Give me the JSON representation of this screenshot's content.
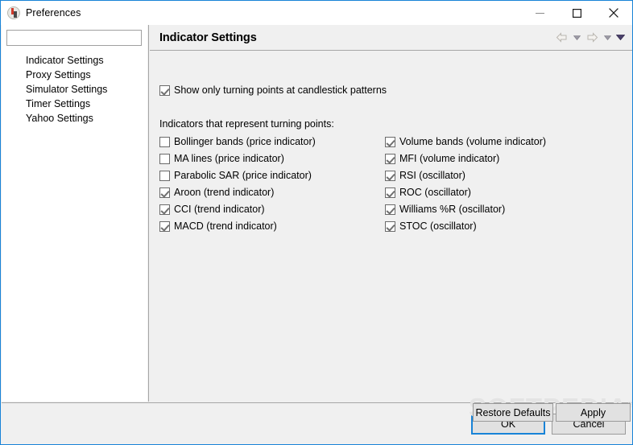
{
  "window": {
    "title": "Preferences",
    "icon": "app-icon",
    "controls": [
      {
        "name": "minimize",
        "glyph": "minimize-icon"
      },
      {
        "name": "maximize",
        "glyph": "maximize-icon"
      },
      {
        "name": "close",
        "glyph": "close-icon"
      }
    ]
  },
  "sidebar": {
    "filter": {
      "value": "",
      "placeholder": ""
    },
    "items": [
      {
        "label": "Indicator Settings",
        "selected": false
      },
      {
        "label": "Proxy Settings",
        "selected": false
      },
      {
        "label": "Simulator Settings",
        "selected": false
      },
      {
        "label": "Timer Settings",
        "selected": false
      },
      {
        "label": "Yahoo Settings",
        "selected": false
      }
    ]
  },
  "page": {
    "title": "Indicator Settings",
    "nav": [
      {
        "name": "back-arrow-icon",
        "label": "Back"
      },
      {
        "name": "back-dropdown-caret-icon",
        "label": "Back history"
      },
      {
        "name": "forward-arrow-icon",
        "label": "Forward"
      },
      {
        "name": "forward-dropdown-caret-icon",
        "label": "Forward history"
      },
      {
        "name": "menu-caret-icon",
        "label": "View menu"
      }
    ],
    "top_option": {
      "label": "Show only turning points at candlestick patterns",
      "checked": true
    },
    "group_caption": "Indicators that represent turning points:",
    "indicators_left": [
      {
        "label": "Bollinger bands (price indicator)",
        "checked": false
      },
      {
        "label": "MA lines (price indicator)",
        "checked": false
      },
      {
        "label": "Parabolic SAR (price indicator)",
        "checked": false
      },
      {
        "label": "Aroon (trend indicator)",
        "checked": true
      },
      {
        "label": "CCI (trend indicator)",
        "checked": true
      },
      {
        "label": "MACD (trend indicator)",
        "checked": true
      }
    ],
    "indicators_right": [
      {
        "label": "Volume bands (volume indicator)",
        "checked": true
      },
      {
        "label": "MFI (volume indicator)",
        "checked": true
      },
      {
        "label": "RSI (oscillator)",
        "checked": true
      },
      {
        "label": "ROC (oscillator)",
        "checked": true
      },
      {
        "label": "Williams %R (oscillator)",
        "checked": true
      },
      {
        "label": "STOC (oscillator)",
        "checked": true
      }
    ],
    "restore_defaults_label": "Restore Defaults",
    "apply_label": "Apply"
  },
  "dialog": {
    "ok_label": "OK",
    "cancel_label": "Cancel"
  },
  "watermark": {
    "text": "SOFTPEDIA",
    "mark": "®"
  },
  "colors": {
    "window_border": "#1883d7",
    "panel_bg": "#f0f0f0",
    "tree_bg": "#ffffff",
    "focus_border": "#1883d7",
    "check_mark": "#707070",
    "watermark": "#e4e4e4"
  }
}
